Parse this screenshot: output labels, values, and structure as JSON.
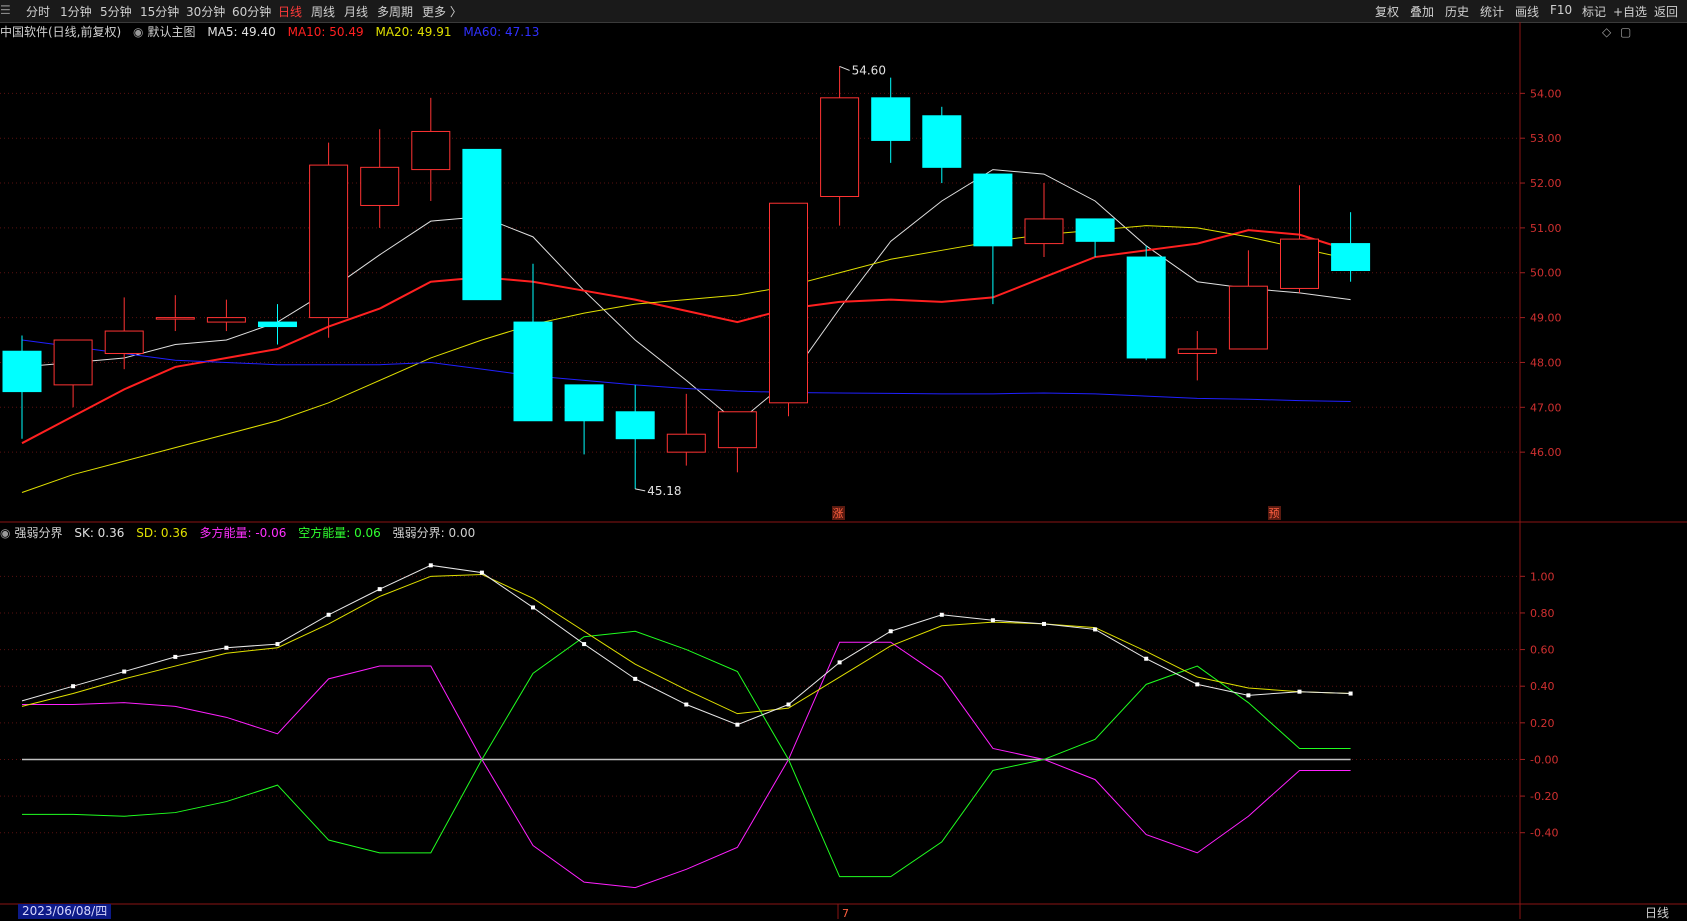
{
  "toolbar": {
    "left": [
      "分时",
      "1分钟",
      "5分钟",
      "15分钟",
      "30分钟",
      "60分钟",
      "日线",
      "周线",
      "月线",
      "多周期",
      "更多 〉"
    ],
    "active": "日线",
    "right": [
      "复权",
      "叠加",
      "历史",
      "统计",
      "画线",
      "F10",
      "标记",
      "+自选",
      "返回"
    ]
  },
  "main_info": {
    "name": "中国软件(日线,前复权)",
    "template": "默认主图",
    "ma5": "MA5: 49.40",
    "ma10": "MA10: 50.49",
    "ma20": "MA20: 49.91",
    "ma60": "MA60: 47.13"
  },
  "sub_info": {
    "name": "强弱分界",
    "sk": "SK: 0.36",
    "sd": "SD: 0.36",
    "duo": "多方能量: -0.06",
    "kong": "空方能量: 0.06",
    "fenjie": "强弱分界: 0.00"
  },
  "markers": {
    "high": "54.60",
    "low": "45.18",
    "zhang": "涨",
    "yu": "预",
    "month": "7"
  },
  "footer": {
    "date": "2023/06/08/四",
    "period": "日线"
  },
  "colors": {
    "up": "#ff3333",
    "down": "#00ffff",
    "ma5": "#e0e0e0",
    "ma10": "#ff2020",
    "ma20": "#e0e000",
    "ma60": "#2020ff"
  },
  "chart_data": [
    {
      "type": "candlestick",
      "ylim": [
        45,
        54.6
      ],
      "yticks": [
        "54.00",
        "53.00",
        "52.00",
        "51.00",
        "50.00",
        "49.00",
        "48.00",
        "47.00",
        "46.00"
      ],
      "candles": [
        {
          "o": 48.25,
          "c": 47.35,
          "h": 48.6,
          "l": 46.3
        },
        {
          "o": 47.5,
          "c": 48.5,
          "h": 48.5,
          "l": 47.0
        },
        {
          "o": 48.2,
          "c": 48.7,
          "h": 49.45,
          "l": 47.85
        },
        {
          "o": 49.0,
          "c": 49.0,
          "h": 49.5,
          "l": 48.7
        },
        {
          "o": 48.9,
          "c": 49.0,
          "h": 49.4,
          "l": 48.7
        },
        {
          "o": 48.9,
          "c": 48.8,
          "h": 49.3,
          "l": 48.4
        },
        {
          "o": 49.0,
          "c": 52.4,
          "h": 52.9,
          "l": 48.55
        },
        {
          "o": 51.5,
          "c": 52.35,
          "h": 53.2,
          "l": 51.0
        },
        {
          "o": 52.3,
          "c": 53.15,
          "h": 53.9,
          "l": 51.6
        },
        {
          "o": 52.75,
          "c": 49.4,
          "h": 52.75,
          "l": 49.4
        },
        {
          "o": 48.9,
          "c": 46.7,
          "h": 50.2,
          "l": 46.7
        },
        {
          "o": 47.5,
          "c": 46.7,
          "h": 47.5,
          "l": 45.95
        },
        {
          "o": 46.9,
          "c": 46.3,
          "h": 47.5,
          "l": 45.18
        },
        {
          "o": 46.0,
          "c": 46.4,
          "h": 47.3,
          "l": 45.7
        },
        {
          "o": 46.1,
          "c": 46.9,
          "h": 46.9,
          "l": 45.55
        },
        {
          "o": 47.1,
          "c": 51.55,
          "h": 51.55,
          "l": 46.8
        },
        {
          "o": 51.7,
          "c": 53.9,
          "h": 54.6,
          "l": 51.05
        },
        {
          "o": 53.9,
          "c": 52.95,
          "h": 54.35,
          "l": 52.45
        },
        {
          "o": 53.5,
          "c": 52.35,
          "h": 53.7,
          "l": 52.0
        },
        {
          "o": 52.2,
          "c": 50.6,
          "h": 52.2,
          "l": 49.3
        },
        {
          "o": 50.65,
          "c": 51.2,
          "h": 52.0,
          "l": 50.35
        },
        {
          "o": 51.2,
          "c": 50.7,
          "h": 51.2,
          "l": 50.35
        },
        {
          "o": 50.35,
          "c": 48.1,
          "h": 50.6,
          "l": 48.05
        },
        {
          "o": 48.2,
          "c": 48.3,
          "h": 48.7,
          "l": 47.6
        },
        {
          "o": 48.3,
          "c": 49.7,
          "h": 50.5,
          "l": 48.3
        },
        {
          "o": 49.65,
          "c": 50.75,
          "h": 51.95,
          "l": 49.55
        },
        {
          "o": 50.65,
          "c": 50.05,
          "h": 51.35,
          "l": 49.8
        }
      ],
      "series": [
        {
          "name": "MA5",
          "values": [
            47.9,
            48.0,
            48.1,
            48.4,
            48.5,
            48.9,
            49.6,
            50.4,
            51.15,
            51.25,
            50.8,
            49.6,
            48.5,
            47.6,
            46.65,
            47.6,
            49.2,
            50.7,
            51.6,
            52.3,
            52.2,
            51.6,
            50.6,
            49.8,
            49.65,
            49.55,
            49.4
          ]
        },
        {
          "name": "MA10",
          "values": [
            46.2,
            46.8,
            47.4,
            47.9,
            48.1,
            48.3,
            48.8,
            49.2,
            49.8,
            49.9,
            49.8,
            49.6,
            49.4,
            49.15,
            48.9,
            49.2,
            49.35,
            49.4,
            49.35,
            49.45,
            49.9,
            50.35,
            50.5,
            50.65,
            50.95,
            50.85,
            50.49
          ]
        },
        {
          "name": "MA20",
          "values": [
            45.1,
            45.5,
            45.8,
            46.1,
            46.4,
            46.7,
            47.1,
            47.6,
            48.1,
            48.5,
            48.85,
            49.1,
            49.3,
            49.4,
            49.5,
            49.7,
            50.0,
            50.3,
            50.5,
            50.7,
            50.85,
            50.95,
            51.05,
            51.0,
            50.8,
            50.55,
            50.3
          ]
        },
        {
          "name": "MA60",
          "values": [
            48.5,
            48.35,
            48.2,
            48.05,
            48.0,
            47.95,
            47.95,
            47.95,
            48.0,
            47.85,
            47.7,
            47.6,
            47.5,
            47.42,
            47.36,
            47.33,
            47.32,
            47.31,
            47.3,
            47.3,
            47.32,
            47.3,
            47.25,
            47.2,
            47.18,
            47.15,
            47.13
          ]
        }
      ]
    },
    {
      "type": "line",
      "ylim": [
        -0.62,
        1.1
      ],
      "yticks": [
        "1.00",
        "0.80",
        "0.60",
        "0.40",
        "0.20",
        "-0.00",
        "-0.20",
        "-0.40"
      ],
      "series": [
        {
          "name": "SK",
          "values": [
            0.32,
            0.4,
            0.48,
            0.56,
            0.61,
            0.63,
            0.79,
            0.93,
            1.06,
            1.02,
            0.83,
            0.63,
            0.44,
            0.3,
            0.19,
            0.3,
            0.53,
            0.7,
            0.79,
            0.76,
            0.74,
            0.71,
            0.55,
            0.41,
            0.35,
            0.37,
            0.36
          ]
        },
        {
          "name": "SD",
          "values": [
            0.29,
            0.36,
            0.44,
            0.51,
            0.58,
            0.61,
            0.74,
            0.89,
            1.0,
            1.01,
            0.88,
            0.7,
            0.52,
            0.38,
            0.25,
            0.28,
            0.45,
            0.62,
            0.73,
            0.75,
            0.74,
            0.72,
            0.59,
            0.45,
            0.39,
            0.37,
            0.36
          ]
        },
        {
          "name": "多方能量",
          "values": [
            0.3,
            0.3,
            0.31,
            0.29,
            0.23,
            0.14,
            0.44,
            0.51,
            0.51,
            0.0,
            -0.47,
            -0.67,
            -0.7,
            -0.6,
            -0.48,
            0.0,
            0.64,
            0.64,
            0.45,
            0.06,
            0.0,
            -0.11,
            -0.41,
            -0.51,
            -0.31,
            -0.06,
            -0.06
          ]
        },
        {
          "name": "空方能量",
          "values": [
            -0.3,
            -0.3,
            -0.31,
            -0.29,
            -0.23,
            -0.14,
            -0.44,
            -0.51,
            -0.51,
            0.0,
            0.47,
            0.67,
            0.7,
            0.6,
            0.48,
            0.0,
            -0.64,
            -0.64,
            -0.45,
            -0.06,
            0.0,
            0.11,
            0.41,
            0.51,
            0.31,
            0.06,
            0.06
          ]
        },
        {
          "name": "强弱分界",
          "values": [
            0,
            0,
            0,
            0,
            0,
            0,
            0,
            0,
            0,
            0,
            0,
            0,
            0,
            0,
            0,
            0,
            0,
            0,
            0,
            0,
            0,
            0,
            0,
            0,
            0,
            0,
            0
          ]
        }
      ]
    }
  ]
}
